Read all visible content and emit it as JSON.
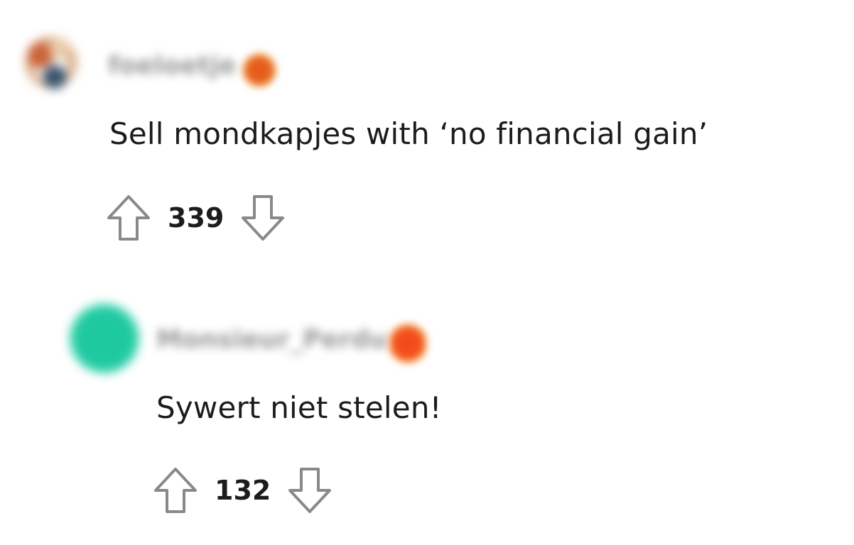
{
  "comments": [
    {
      "username": "foeloetje",
      "text": "Sell mondkapjes with ‘no financial gain’",
      "score": "339"
    },
    {
      "username": "Monsieur_Perdu",
      "text": "Sywert niet stelen!",
      "score": "132"
    }
  ],
  "colors": {
    "text": "#1c1c1c",
    "icon_stroke": "#878a8c",
    "reply_avatar": "#1fc9a0",
    "flair": "#e65b1c"
  },
  "icons": {
    "upvote": "upvote-arrow-icon",
    "downvote": "downvote-arrow-icon"
  }
}
